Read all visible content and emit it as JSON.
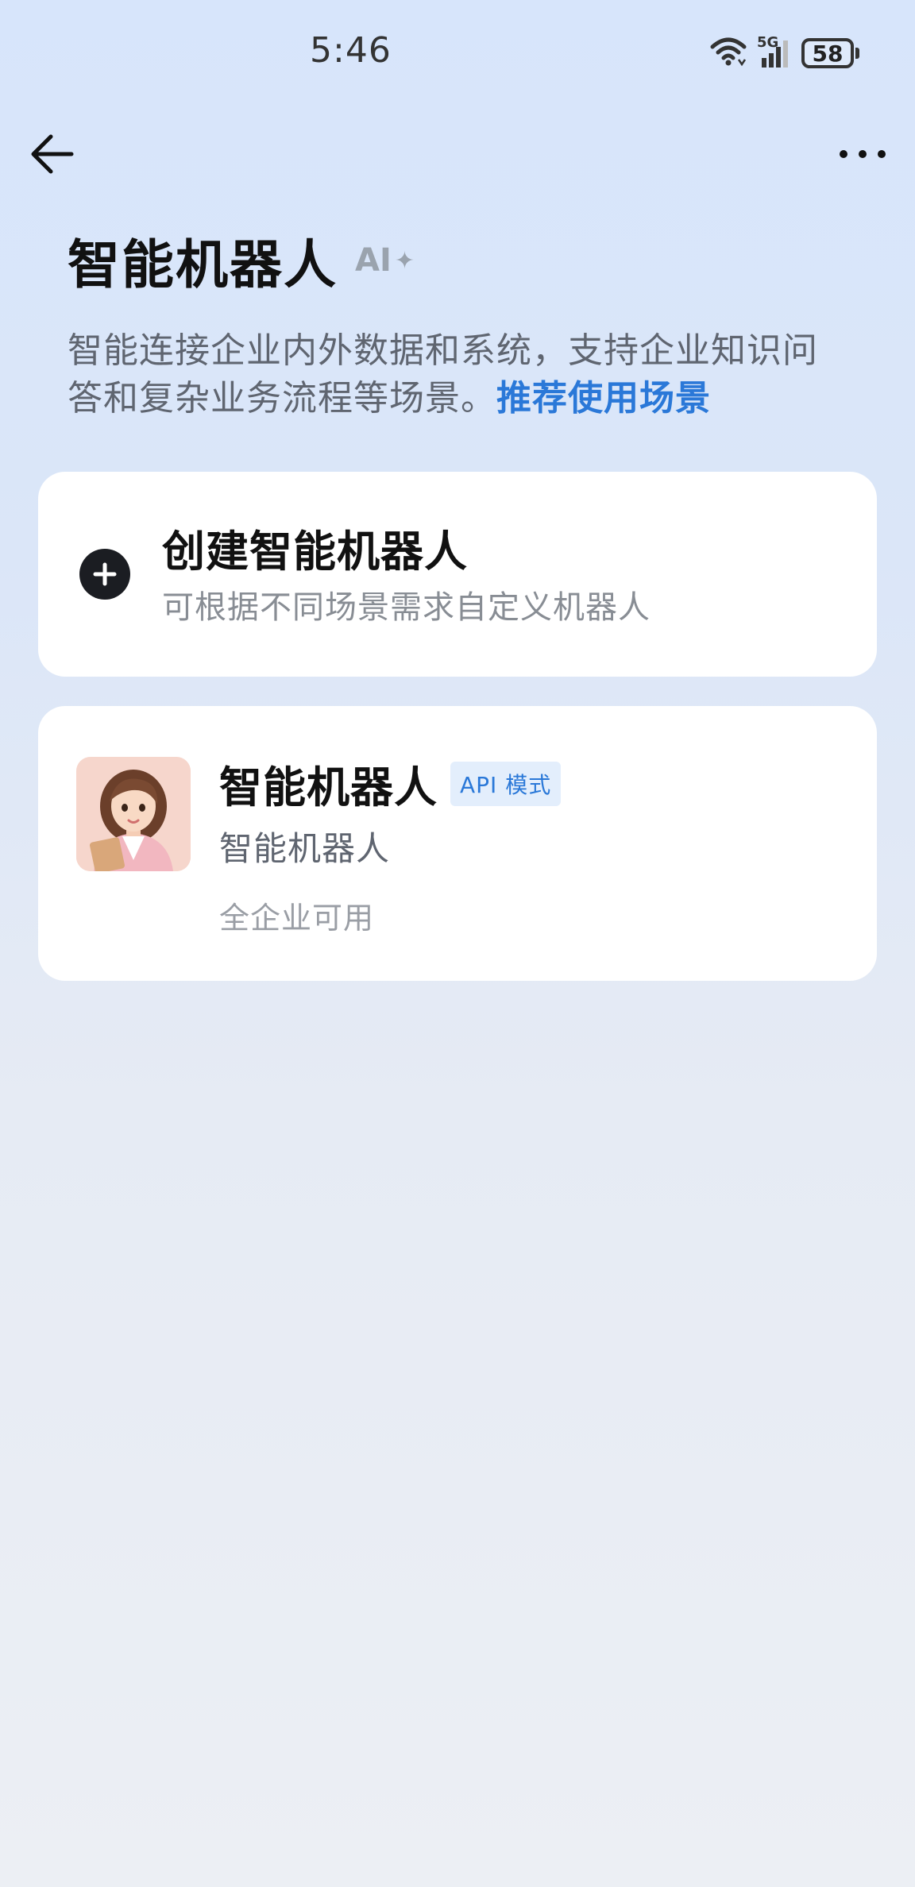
{
  "status_bar": {
    "time": "5:46",
    "network": "5G",
    "battery": "58",
    "icons": [
      "wifi-icon",
      "signal-icon",
      "battery-icon"
    ]
  },
  "nav": {
    "back_icon": "arrow-left-icon",
    "more_icon": "more-horizontal-icon"
  },
  "header": {
    "title": "智能机器人",
    "ai_badge": "AI",
    "description": "智能连接企业内外数据和系统，支持企业知识问答和复杂业务流程等场景。",
    "link_text": "推荐使用场景"
  },
  "create_card": {
    "icon": "plus-circle-icon",
    "title": "创建智能机器人",
    "subtitle": "可根据不同场景需求自定义机器人"
  },
  "bots": [
    {
      "name": "智能机器人",
      "badge": "API 模式",
      "description": "智能机器人",
      "scope": "全企业可用",
      "avatar": "assistant-avatar"
    }
  ],
  "colors": {
    "accent": "#2a78d8",
    "background_top": "#d7e5fb",
    "background_bottom": "#eceff4",
    "card": "#ffffff"
  }
}
